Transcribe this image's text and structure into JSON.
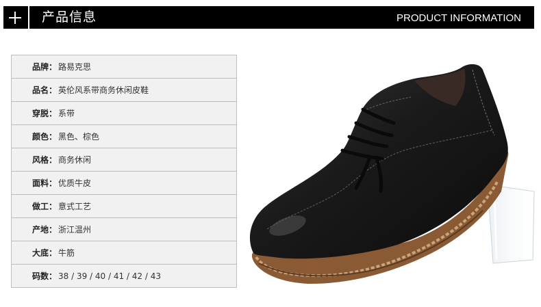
{
  "header": {
    "icon": "plus-icon",
    "title_cn": "产品信息",
    "title_en": "PRODUCT INFORMATION"
  },
  "specs": [
    {
      "label": "品牌：",
      "value": "路易克思"
    },
    {
      "label": "品名：",
      "value": "英伦风系带商务休闲皮鞋"
    },
    {
      "label": "穿脱：",
      "value": "系带"
    },
    {
      "label": "颜色：",
      "value": "黑色、棕色"
    },
    {
      "label": "风格：",
      "value": "商务休闲"
    },
    {
      "label": "面料：",
      "value": "优质牛皮"
    },
    {
      "label": "做工：",
      "value": "意式工艺"
    },
    {
      "label": "产地：",
      "value": "浙江温州"
    },
    {
      "label": "大底：",
      "value": "牛筋"
    },
    {
      "label": "码数：",
      "value": "38 / 39 / 40 / 41 / 42 / 43"
    }
  ],
  "colors": {
    "header_bg": "#000000",
    "row_bg": "#f1f1f1",
    "border": "#bdbdbd",
    "shoe": "#1b1b1b",
    "sole": "#8a5a34"
  }
}
